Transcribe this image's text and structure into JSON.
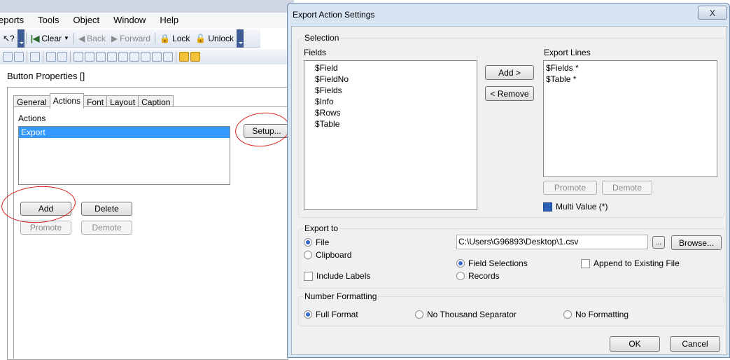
{
  "app": {
    "menu": [
      "eports",
      "Tools",
      "Object",
      "Window",
      "Help"
    ],
    "toolbar": {
      "clear": "Clear",
      "back": "Back",
      "forward": "Forward",
      "lock": "Lock",
      "unlock": "Unlock"
    },
    "properties_title": "Button Properties []",
    "tabs": [
      "General",
      "Actions",
      "Font",
      "Layout",
      "Caption"
    ],
    "active_tab": "Actions",
    "actions_label": "Actions",
    "actions_list": [
      "Export"
    ],
    "setup_button": "Setup...",
    "add_button": "Add",
    "delete_button": "Delete",
    "promote_button": "Promote",
    "demote_button": "Demote"
  },
  "dialog": {
    "title": "Export Action Settings",
    "close": "X",
    "selection_label": "Selection",
    "fields_label": "Fields",
    "fields": [
      "$Field",
      "$FieldNo",
      "$Fields",
      "$Info",
      "$Rows",
      "$Table"
    ],
    "add_button": "Add >",
    "remove_button": "< Remove",
    "export_lines_label": "Export Lines",
    "export_lines": [
      "$Fields *",
      "$Table *"
    ],
    "promote_button": "Promote",
    "demote_button": "Demote",
    "multi_value": "Multi Value (*)",
    "export_to_label": "Export to",
    "file_radio": "File",
    "clipboard_radio": "Clipboard",
    "file_path": "C:\\Users\\G96893\\Desktop\\1.csv",
    "dots_button": "...",
    "browse_button": "Browse...",
    "include_labels": "Include Labels",
    "field_selections": "Field Selections",
    "records": "Records",
    "append_existing": "Append to Existing File",
    "number_formatting_label": "Number Formatting",
    "full_format": "Full Format",
    "no_thousand": "No Thousand Separator",
    "no_formatting": "No Formatting",
    "ok_button": "OK",
    "cancel_button": "Cancel"
  }
}
